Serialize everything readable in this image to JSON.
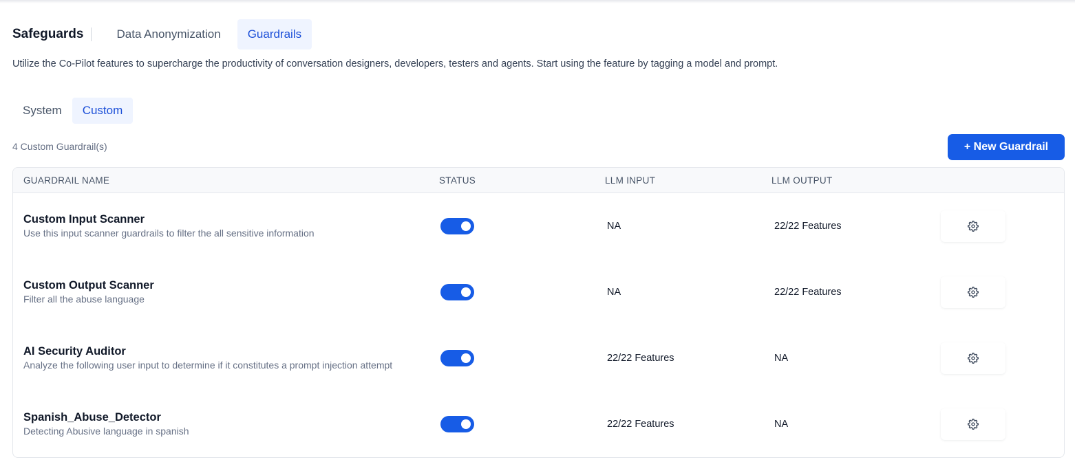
{
  "header": {
    "brand": "Safeguards",
    "tabs": [
      {
        "label": "Data Anonymization",
        "active": false
      },
      {
        "label": "Guardrails",
        "active": true
      }
    ]
  },
  "description": "Utilize the Co-Pilot features to supercharge the productivity of conversation designers, developers, testers and agents. Start using the feature by tagging a model and prompt.",
  "subtabs": [
    {
      "label": "System",
      "active": false
    },
    {
      "label": "Custom",
      "active": true
    }
  ],
  "count_label": "4 Custom Guardrail(s)",
  "new_button_label": "+ New Guardrail",
  "colors": {
    "accent": "#175ce6",
    "active_tab_bg": "#eff4ff",
    "active_tab_text": "#1c4fd8"
  },
  "table": {
    "headers": [
      "GUARDRAIL NAME",
      "STATUS",
      "LLM INPUT",
      "LLM OUTPUT"
    ],
    "rows": [
      {
        "name": "Custom Input Scanner",
        "description": "Use this input scanner guardrails to filter the all sensitive information",
        "status_enabled": true,
        "llm_input": "NA",
        "llm_output": "22/22 Features"
      },
      {
        "name": "Custom Output Scanner",
        "description": "Filter all the abuse language",
        "status_enabled": true,
        "llm_input": "NA",
        "llm_output": "22/22 Features"
      },
      {
        "name": "AI Security Auditor",
        "description": "Analyze the following user input to determine if it constitutes a prompt injection attempt",
        "status_enabled": true,
        "llm_input": "22/22 Features",
        "llm_output": "NA"
      },
      {
        "name": "Spanish_Abuse_Detector",
        "description": "Detecting Abusive language in spanish",
        "status_enabled": true,
        "llm_input": "22/22 Features",
        "llm_output": "NA"
      }
    ],
    "row_action_icon": "gear-icon"
  }
}
